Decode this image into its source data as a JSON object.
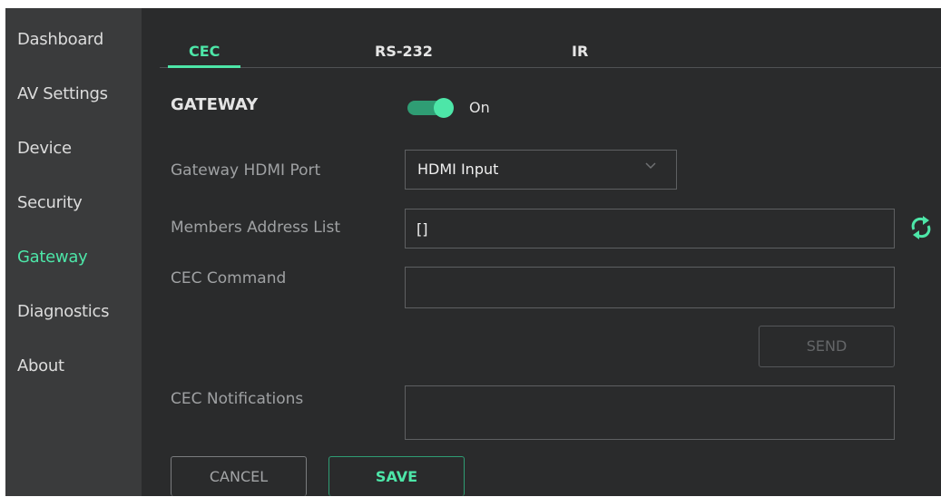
{
  "sidebar": {
    "items": [
      {
        "label": "Dashboard"
      },
      {
        "label": "AV Settings"
      },
      {
        "label": "Device"
      },
      {
        "label": "Security"
      },
      {
        "label": "Gateway"
      },
      {
        "label": "Diagnostics"
      },
      {
        "label": "About"
      }
    ],
    "active": "Gateway"
  },
  "tabs": [
    {
      "label": "CEC",
      "active": true
    },
    {
      "label": "RS-232",
      "active": false
    },
    {
      "label": "IR",
      "active": false
    }
  ],
  "gateway": {
    "title": "GATEWAY",
    "toggle_state": "On",
    "toggle_on": true,
    "hdmi_port_label": "Gateway HDMI Port",
    "hdmi_port_value": "HDMI Input",
    "members_label": "Members Address List",
    "members_value": "[]",
    "cec_command_label": "CEC Command",
    "cec_command_value": "",
    "send_label": "SEND",
    "notifications_label": "CEC Notifications",
    "notifications_value": ""
  },
  "footer": {
    "cancel_label": "CANCEL",
    "save_label": "SAVE"
  },
  "colors": {
    "accent": "#4de6a8",
    "background": "#2a2b2c",
    "sidebar": "#3a3b3c"
  },
  "icons": {
    "refresh": "refresh-icon",
    "chevron": "chevron-down-icon"
  }
}
